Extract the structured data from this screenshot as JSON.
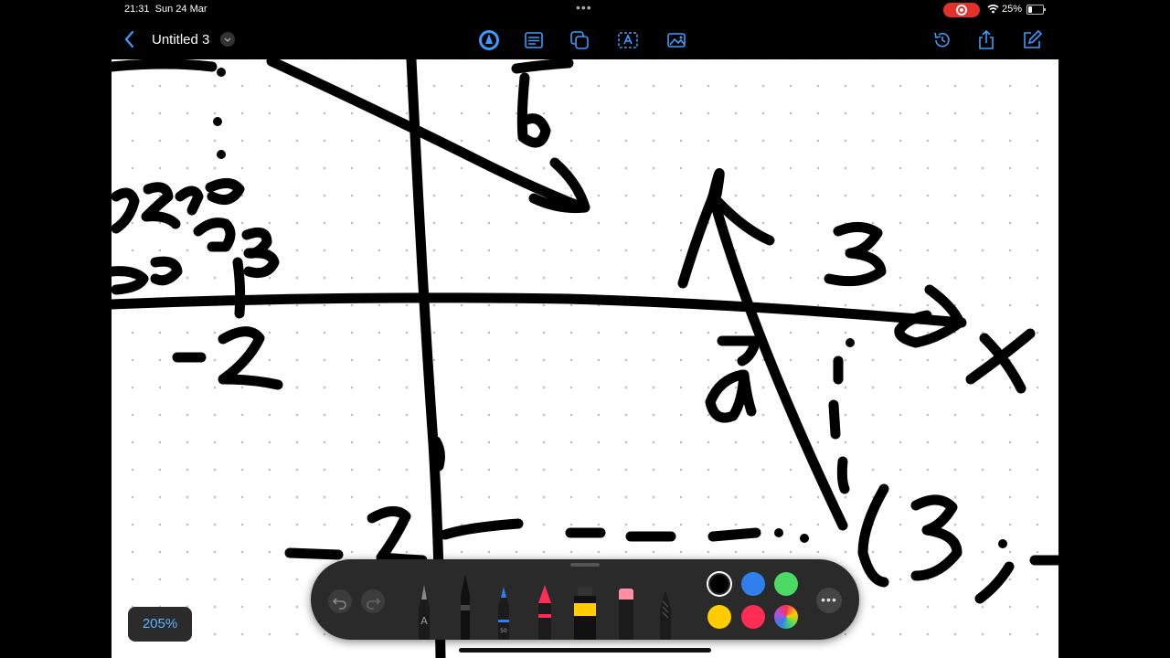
{
  "status": {
    "time": "21:31",
    "date": "Sun 24 Mar",
    "battery_pct": "25%",
    "battery_level": 0.25
  },
  "toolbar": {
    "title": "Untitled 3"
  },
  "zoom": {
    "level": "205%"
  },
  "palette": {
    "pen_label": "A",
    "pen_size": "50",
    "colors": [
      "#000000",
      "#2f80ed",
      "#4cd964",
      "#ffcc00",
      "#ff2d55",
      "multicolor"
    ],
    "selected_color": "#000000"
  },
  "canvas": {
    "handwriting": [
      {
        "text": "b"
      },
      {
        "text": "3"
      },
      {
        "text": "-2"
      },
      {
        "text": "a"
      },
      {
        "text": "x"
      },
      {
        "text": "(3;"
      },
      {
        "text": "-2"
      }
    ]
  }
}
